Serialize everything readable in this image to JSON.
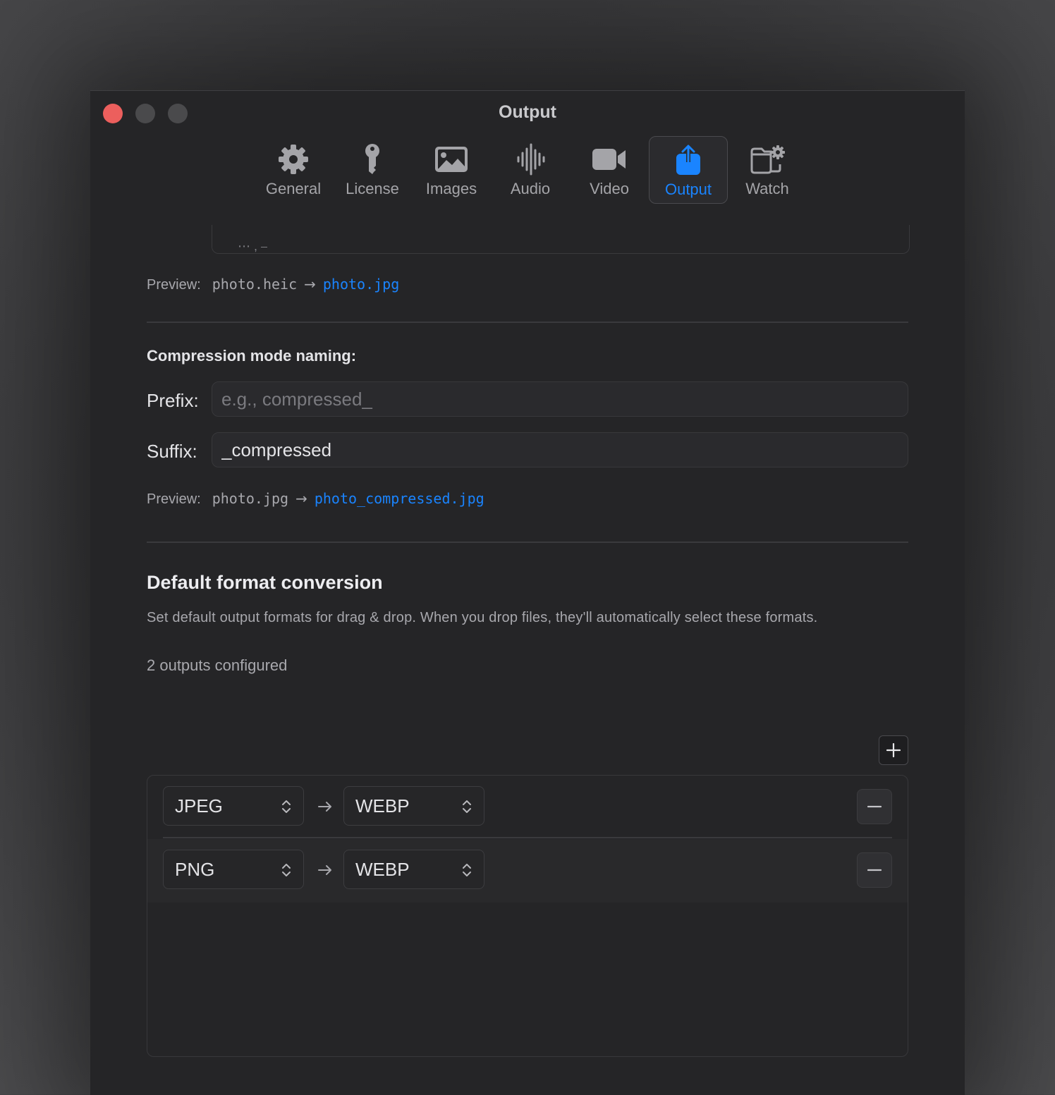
{
  "window": {
    "title": "Output"
  },
  "tabs": [
    {
      "label": "General",
      "icon": "gear-icon",
      "active": false
    },
    {
      "label": "License",
      "icon": "key-icon",
      "active": false
    },
    {
      "label": "Images",
      "icon": "photo-icon",
      "active": false
    },
    {
      "label": "Audio",
      "icon": "waveform-icon",
      "active": false
    },
    {
      "label": "Video",
      "icon": "video-camera-icon",
      "active": false
    },
    {
      "label": "Output",
      "icon": "share-icon",
      "active": true
    },
    {
      "label": "Watch",
      "icon": "folder-gear-icon",
      "active": false
    }
  ],
  "conversion_preview": {
    "label": "Preview:",
    "source": "photo.heic",
    "arrow": "→",
    "result": "photo.jpg"
  },
  "compression_naming": {
    "heading": "Compression mode naming:",
    "prefix_label": "Prefix:",
    "prefix_value": "",
    "prefix_placeholder": "e.g., compressed_",
    "suffix_label": "Suffix:",
    "suffix_value": "_compressed",
    "preview_label": "Preview:",
    "preview_source": "photo.jpg",
    "preview_arrow": "→",
    "preview_result": "photo_compressed.jpg"
  },
  "default_format": {
    "heading": "Default format conversion",
    "description": "Set default output formats for drag & drop. When you drop files, they'll automatically select these formats.",
    "count_text": "2 outputs configured",
    "outputs": [
      {
        "from": "JPEG",
        "to": "WEBP"
      },
      {
        "from": "PNG",
        "to": "WEBP"
      }
    ]
  },
  "colors": {
    "accent": "#1a84ff",
    "window_bg": "#252527",
    "close_button": "#ec5f5d"
  }
}
